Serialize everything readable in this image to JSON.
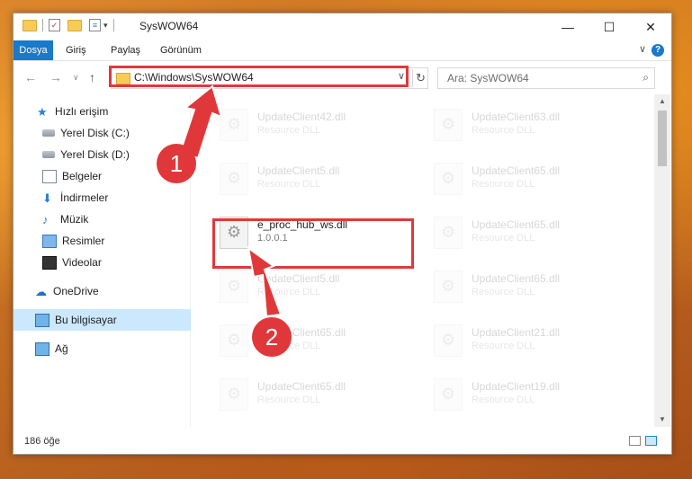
{
  "window": {
    "title": "SysWOW64"
  },
  "controls": {
    "minimize": "—",
    "maximize": "☐",
    "close": "✕"
  },
  "menu": {
    "items": [
      "Dosya",
      "Giriş",
      "Paylaş",
      "Görünüm"
    ],
    "help": "?"
  },
  "address": {
    "path": "C:\\Windows\\SysWOW64"
  },
  "search": {
    "placeholder": "Ara: SysWOW64"
  },
  "sidebar": {
    "items": [
      {
        "label": "Hızlı erişim",
        "icon": "star-icon",
        "pinned": false
      },
      {
        "label": "Yerel Disk (C:)",
        "icon": "drive-icon",
        "pinned": true
      },
      {
        "label": "Yerel Disk (D:)",
        "icon": "drive-icon",
        "pinned": false
      },
      {
        "label": "Belgeler",
        "icon": "document-icon",
        "pinned": true
      },
      {
        "label": "İndirmeler",
        "icon": "download-icon",
        "pinned": true
      },
      {
        "label": "Müzik",
        "icon": "music-icon",
        "pinned": true
      },
      {
        "label": "Resimler",
        "icon": "pictures-icon",
        "pinned": true
      },
      {
        "label": "Videolar",
        "icon": "videos-icon",
        "pinned": true
      },
      {
        "label": "OneDrive",
        "icon": "cloud-icon",
        "pinned": false
      },
      {
        "label": "Bu bilgisayar",
        "icon": "pc-icon",
        "pinned": false
      },
      {
        "label": "Ağ",
        "icon": "network-icon",
        "pinned": false
      }
    ]
  },
  "files": {
    "left": [
      {
        "name": "UpdateClient42.dll",
        "sub": "Resource DLL"
      },
      {
        "name": "UpdateClient5.dll",
        "sub": "Resource DLL"
      },
      {
        "name": "e_proc_hub_ws.dll",
        "sub": "1.0.0.1"
      },
      {
        "name": "UpdateClient5.dll",
        "sub": "Resource DLL"
      },
      {
        "name": "UpdateClient65.dll",
        "sub": "Resource DLL"
      },
      {
        "name": "UpdateClient65.dll",
        "sub": "Resource DLL"
      }
    ],
    "right": [
      {
        "name": "UpdateClient63.dll",
        "sub": "Resource DLL"
      },
      {
        "name": "UpdateClient65.dll",
        "sub": "Resource DLL"
      },
      {
        "name": "UpdateClient65.dll",
        "sub": "Resource DLL"
      },
      {
        "name": "UpdateClient65.dll",
        "sub": "Resource DLL"
      },
      {
        "name": "UpdateClient21.dll",
        "sub": "Resource DLL"
      },
      {
        "name": "UpdateClient19.dll",
        "sub": "Resource DLL"
      }
    ]
  },
  "status": {
    "count": "186 öğe"
  },
  "annotations": {
    "step1": "1",
    "step2": "2",
    "color": "#e0383a"
  }
}
